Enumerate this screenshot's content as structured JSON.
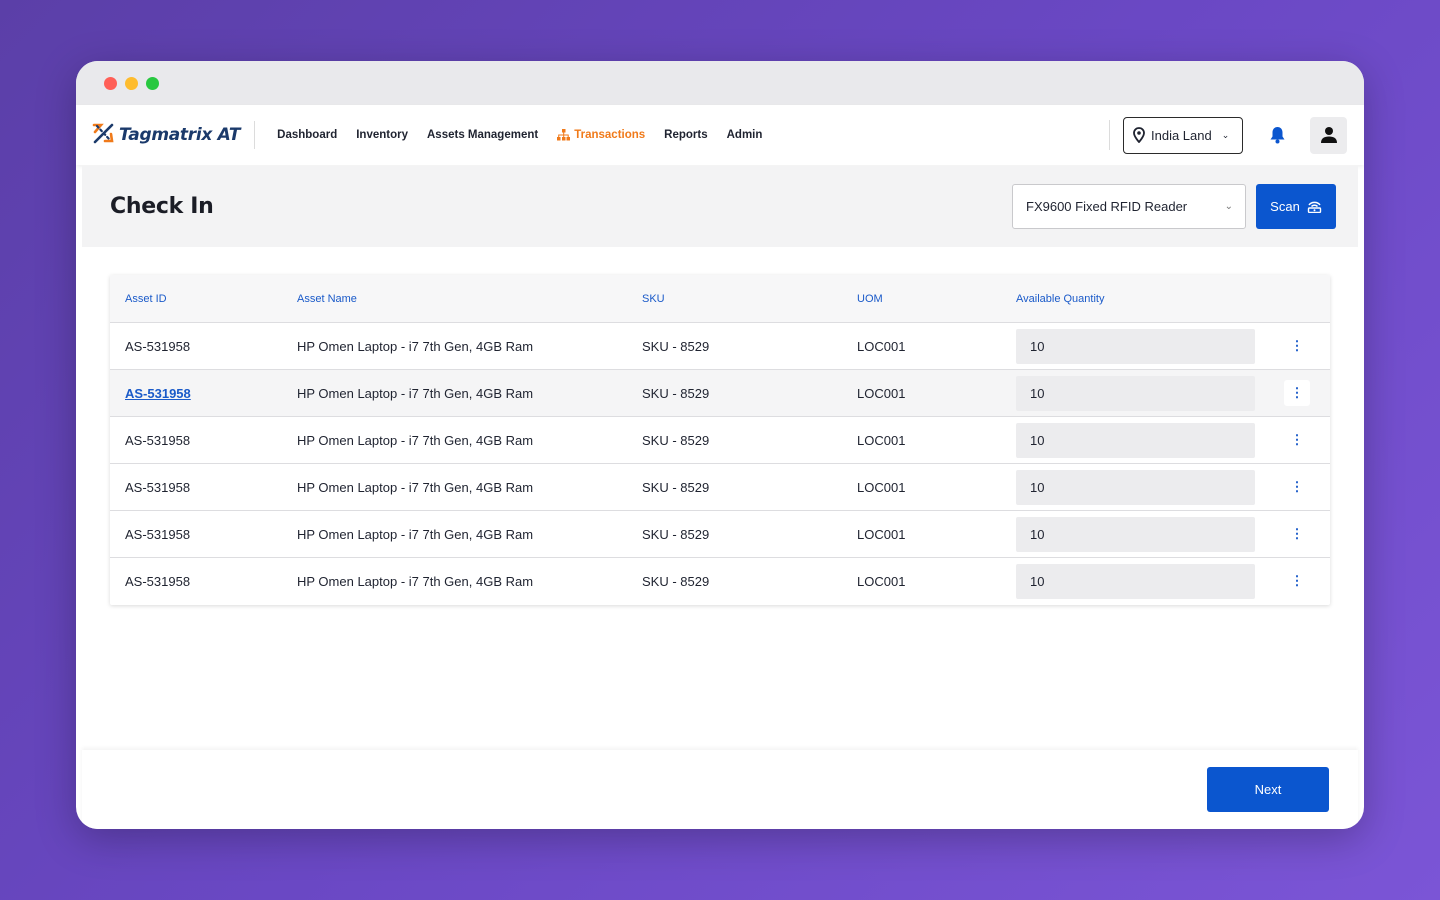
{
  "app": {
    "logo_text": "Tagmatrix AT"
  },
  "nav": {
    "items": [
      {
        "label": "Dashboard"
      },
      {
        "label": "Inventory"
      },
      {
        "label": "Assets Management"
      },
      {
        "label": "Transactions",
        "active": true
      },
      {
        "label": "Reports"
      },
      {
        "label": "Admin"
      }
    ],
    "location": "India Land",
    "accent_color": "#f07a1a"
  },
  "page": {
    "title": "Check In",
    "reader_select_value": "FX9600 Fixed RFID Reader",
    "scan_label": "Scan",
    "next_label": "Next",
    "primary_color": "#0b56cf"
  },
  "table": {
    "headers": [
      "Asset ID",
      "Asset Name",
      "SKU",
      "UOM",
      "Available Quantity"
    ],
    "rows": [
      {
        "asset_id": "AS-531958",
        "asset_name": "HP Omen Laptop - i7 7th Gen, 4GB Ram",
        "sku": "SKU - 8529",
        "uom": "LOC001",
        "qty": "10"
      },
      {
        "asset_id": "AS-531958",
        "asset_name": "HP Omen Laptop - i7 7th Gen, 4GB Ram",
        "sku": "SKU - 8529",
        "uom": "LOC001",
        "qty": "10"
      },
      {
        "asset_id": "AS-531958",
        "asset_name": "HP Omen Laptop - i7 7th Gen, 4GB Ram",
        "sku": "SKU - 8529",
        "uom": "LOC001",
        "qty": "10"
      },
      {
        "asset_id": "AS-531958",
        "asset_name": "HP Omen Laptop - i7 7th Gen, 4GB Ram",
        "sku": "SKU - 8529",
        "uom": "LOC001",
        "qty": "10"
      },
      {
        "asset_id": "AS-531958",
        "asset_name": "HP Omen Laptop - i7 7th Gen, 4GB Ram",
        "sku": "SKU - 8529",
        "uom": "LOC001",
        "qty": "10"
      },
      {
        "asset_id": "AS-531958",
        "asset_name": "HP Omen Laptop - i7 7th Gen, 4GB Ram",
        "sku": "SKU - 8529",
        "uom": "LOC001",
        "qty": "10"
      }
    ]
  }
}
